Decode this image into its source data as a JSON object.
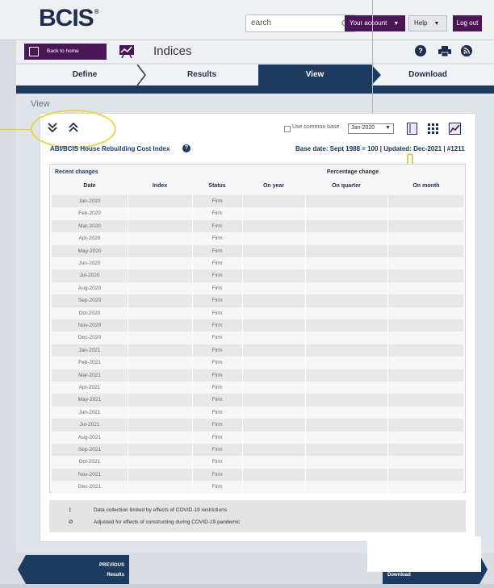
{
  "header": {
    "logo": "BCIS",
    "logo_mark": "®",
    "search_value": "earch",
    "your_account": "Your account",
    "help": "Help",
    "logout": "Log out"
  },
  "subheader": {
    "back_label": "Back to home",
    "page_title": "Indices"
  },
  "steps": [
    {
      "label": "Define"
    },
    {
      "label": "Results"
    },
    {
      "label": "View",
      "active": true
    },
    {
      "label": "Download"
    }
  ],
  "view": {
    "section_label": "View",
    "use_common_base_label": "Use common base",
    "common_base_selected": "Jan-2020",
    "index_title": "ABI/BCIS House Rebuilding Cost Index",
    "base_info": "Base date: Sept 1988 = 100 | Updated: Dec-2021 | #1211"
  },
  "table": {
    "caption": "Recent changes",
    "group_header": "Percentage change",
    "columns": [
      "Date",
      "Index",
      "Status",
      "On year",
      "On quarter",
      "On month"
    ],
    "rows": [
      {
        "date": "Jan-2020",
        "status": "Firm"
      },
      {
        "date": "Feb-2020",
        "status": "Firm"
      },
      {
        "date": "Mar-2020",
        "status": "Firm"
      },
      {
        "date": "Apr-2020",
        "status": "Firm"
      },
      {
        "date": "May-2020",
        "status": "Firm"
      },
      {
        "date": "Jun-2020",
        "status": "Firm"
      },
      {
        "date": "Jul-2020",
        "status": "Firm"
      },
      {
        "date": "Aug-2020",
        "status": "Firm"
      },
      {
        "date": "Sep-2020",
        "status": "Firm"
      },
      {
        "date": "Oct-2020",
        "status": "Firm"
      },
      {
        "date": "Nov-2020",
        "status": "Firm"
      },
      {
        "date": "Dec-2020",
        "status": "Firm"
      },
      {
        "date": "Jan-2021",
        "status": "Firm"
      },
      {
        "date": "Feb-2021",
        "status": "Firm"
      },
      {
        "date": "Mar-2021",
        "status": "Firm"
      },
      {
        "date": "Apr-2021",
        "status": "Firm"
      },
      {
        "date": "May-2021",
        "status": "Firm"
      },
      {
        "date": "Jun-2021",
        "status": "Firm"
      },
      {
        "date": "Jul-2021",
        "status": "Firm"
      },
      {
        "date": "Aug-2021",
        "status": "Firm"
      },
      {
        "date": "Sep-2021",
        "status": "Firm"
      },
      {
        "date": "Oct-2021",
        "status": "Firm"
      },
      {
        "date": "Nov-2021",
        "status": "Firm"
      },
      {
        "date": "Dec-2021",
        "status": "Firm"
      }
    ]
  },
  "notes": [
    {
      "symbol": "‡",
      "text": "Data collection limited by effects of COVID-19 restrictions"
    },
    {
      "symbol": "Ø",
      "text": "Adjusted for effects of constructing during COVID-19 pandemic"
    }
  ],
  "nav": {
    "previous": "PREVIOUS",
    "previous_target": "Results",
    "next_target": "Download"
  },
  "colors": {
    "brand_purple": "#4a1656",
    "navy": "#1e3a5f",
    "highlight": "#e8d54a"
  }
}
